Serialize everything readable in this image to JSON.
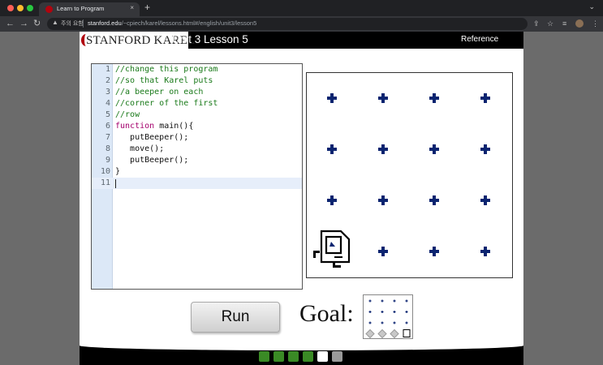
{
  "browser": {
    "tab_title": "Learn to Program",
    "tab_close": "×",
    "new_tab": "+",
    "window_menu": "⌄",
    "back": "←",
    "forward": "→",
    "reload": "↻",
    "insecure_label": "주의 요함",
    "url_host": "stanford.edu",
    "url_path": "/~cpiech/karel/lessons.html#/english/unit3/lesson5",
    "colors": {
      "titlebar": "#202124",
      "toolbar": "#35363a"
    }
  },
  "header": {
    "logo_text": "STANFORD KAREL",
    "lesson_title": "Unit 3 Lesson 5",
    "reference_link": "Reference"
  },
  "editor": {
    "lines": [
      {
        "num": "1",
        "text": "//change this program",
        "kind": "comment"
      },
      {
        "num": "2",
        "text": "//so that Karel puts",
        "kind": "comment"
      },
      {
        "num": "3",
        "text": "//a beeper on each",
        "kind": "comment"
      },
      {
        "num": "4",
        "text": "//corner of the first",
        "kind": "comment"
      },
      {
        "num": "5",
        "text": "//row",
        "kind": "comment"
      },
      {
        "num": "6",
        "kw": "function",
        "text": " main(){",
        "kind": "keyword"
      },
      {
        "num": "7",
        "text": "   putBeeper();",
        "kind": "plain"
      },
      {
        "num": "8",
        "text": "   move();",
        "kind": "plain"
      },
      {
        "num": "9",
        "text": "   putBeeper();",
        "kind": "plain"
      },
      {
        "num": "10",
        "text": "}",
        "kind": "plain"
      },
      {
        "num": "11",
        "text": "",
        "kind": "plain"
      }
    ],
    "active_line": 11
  },
  "world": {
    "rows": 4,
    "cols": 4,
    "karel_position": {
      "row": 1,
      "col": 1
    },
    "karel_facing": "east",
    "corner_color": "#0b2470"
  },
  "controls": {
    "run_label": "Run",
    "goal_label": "Goal:"
  },
  "progress": {
    "dots": [
      "complete",
      "complete",
      "complete",
      "complete",
      "current",
      "locked"
    ],
    "colors": {
      "complete": "#3a8a25",
      "current": "#ffffff",
      "locked": "#9a9a9a"
    }
  }
}
